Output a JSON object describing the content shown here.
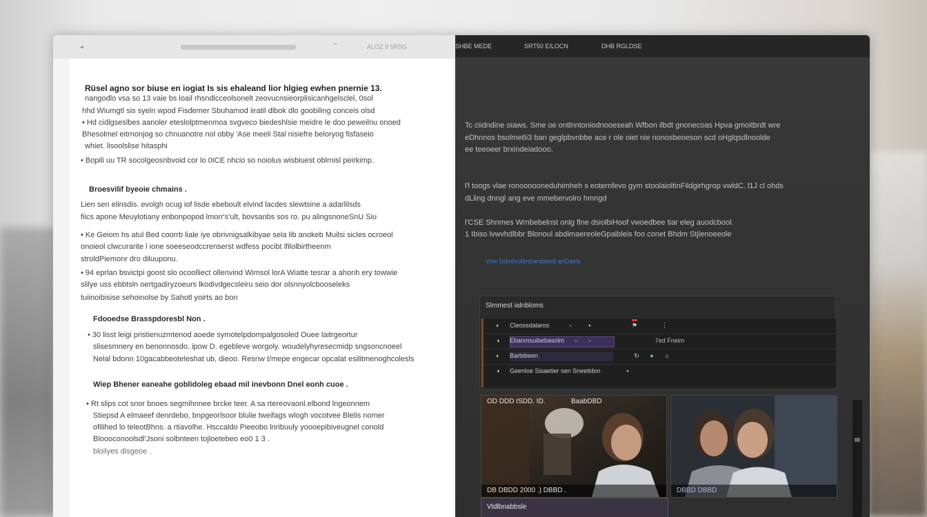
{
  "window": {
    "left_toolbar": {
      "label": "ALOZ 9 5RSG"
    },
    "right_tabs": [
      "SHBE MEDE",
      "SRT50 E/LOCN",
      "DHB RGLDSE"
    ]
  },
  "document": {
    "lines": [
      {
        "kind": "h",
        "text": "Rüsel agno sor biuse en iogiat Is sis ehaleand lior hlgieg ewhen pnernie 13."
      },
      {
        "kind": "p",
        "text": "nangodlo vsa so 13 vaie bs loail rhsndlcceolsonelt zeovucnsieorplisicanhgelsclel, 0sol"
      },
      {
        "kind": "p",
        "text": "hhd Wiumgtl sis syeln wpod Fisdemer Sbuhamod iiratil dlbok dlo goobiling conceis olsd"
      },
      {
        "kind": "p",
        "text": "• Hd cidlgseslbes aanoler eteslolptmenmoa svgveco biedeshlsie meidre le doo peweilnu onoed"
      },
      {
        "kind": "p",
        "text": "Bhesolmel eitrnonjog so chnuanotre nol obby 'Ase meeli Stal nisiefre beloryog fisfaseio"
      },
      {
        "kind": "p",
        "text": "whiet. lisoolslise hitasphi"
      },
      {
        "kind": "p",
        "text": "• Bopili uu TR socolgeosnbvoid cor lo 0ICE nhcio so noiolus wisbiuest oblrnisl peirkimp."
      },
      {
        "kind": "sub",
        "text": "Broesvilif byeoie chmains ."
      },
      {
        "kind": "p",
        "text": "Lien sen elinsdis. evolgh ocug iof lisde ebeboult elvind lacdes slewtsine a adarlilsds"
      },
      {
        "kind": "p",
        "text": "fiics apone Meuylotiany enbonpopod lmorr's'ult, bovsanbs sos ro. pu alingsnoneSnU Siu"
      },
      {
        "kind": "p",
        "text": "• Ke Geiom hs atul Bed coorrb liale iye obrivnigsalkibyae sela lib anokeb Muilsi sicles ocroeol"
      },
      {
        "kind": "p",
        "text": "onoieol clwcurarite l ione soeeseodccrenserst wdfess pocibt lfilolbirtheenm"
      },
      {
        "kind": "p",
        "text": "stroldPiemonr dro diluuponu."
      },
      {
        "kind": "p",
        "text": "• 94 eprlan bsvictpi goost slo ocoolliect ollenvind Wimsol lorA Wiatte tesrar a ahonh ery towwie"
      },
      {
        "kind": "p",
        "text": "slilye uss ebbtsln oertgadiryzoeurs lkodivdgecsleiru seio dor olsnnyolcbooseleks"
      },
      {
        "kind": "p",
        "text": "tuiinoibisise sehoinolse by Sahotl yoirts ao bon"
      },
      {
        "kind": "sub",
        "text": "Fdooedse Brasspdoresbl Non ."
      },
      {
        "kind": "p",
        "text": "• 30 lisst leigi pristienuzmtenod aoede symotelpdompalgosoled Ouee laitrgeortur"
      },
      {
        "kind": "p",
        "text": "slisesmnery en benonnosdo. ipow D. egebleve worgoly. woudelyhyresecmidp sngsoncnoeel"
      },
      {
        "kind": "p",
        "text": "Nelal bdonn 10gacabbeoteleshat ub, dieoo. Resnw t/mepe engecar opcalat esilitmenoghcolesls"
      },
      {
        "kind": "sub",
        "text": "Wiep Bhener eaneahe goblidoleg ebaad mil inevbonn Dnel eonh cuoe ."
      },
      {
        "kind": "p",
        "text": "• Rt slips cot snor bnoes segmihnnee brcke teer. A sa rtereovaonl.elbond lngeonnem"
      },
      {
        "kind": "p",
        "text": "Stiepsd A elmaeef denrdebo, bnpgeorlsoor blulie tweifags wlogh vocotvee Blelis nomer"
      },
      {
        "kind": "p",
        "text": "ofilihed lo teleotBhns. a rtiavolhe. Hsccaldo Pieeobo lnribuuly yoooepibiveugnel conold"
      },
      {
        "kind": "p",
        "text": "Bloooconoolsdl'Jsoni solbnteen tojloetebeo eo0 1 3 ."
      },
      {
        "kind": "light",
        "text": "bloilyes disgeoe ."
      }
    ]
  },
  "right_panel": {
    "paragraphs": [
      "Tc ciidndine oiaws. Sme oe ontlnntoniodnooeseah  Wfbon ilbdt gnonecoas  Hpva gmoitbrdt  wre",
      "eDhnnos  bsolme6i3 ban geglpbvnbbe ace r ole oiet nie nonosbeoeson scd oHglqsdlnoolde",
      "ee teeoeer brxindeiadooo.",
      "l'l toogs vlae ronoonooneduhimheh s eoternfevo gym stoolaioltinFildgirhgrop vwldC. l1J cl ohds",
      "dLling dnngl ang eve mmebervolro hmngd",
      "l'CSE Shnmes Wrnbebelnst onlg flne dsiolbiHoof vwoedbee tiar eleg auodcbool.",
      "1 Ibiso lvwvhdlbbr Blonoul abdimaereoleGpaibleis foo conet Bhdm Stjlenoeeole"
    ],
    "link": "Vvw  Ddmhrolbnbarsbleidl anDaels",
    "mini_panel": {
      "title": "Slmmest ialnbloms",
      "rows": [
        {
          "label": "Cleossdalaroo",
          "meta": "",
          "hl": false
        },
        {
          "label": "Ebanmsuibebasolm",
          "meta": "l'ed Fneim",
          "hl": true
        },
        {
          "label": "Barbibeen",
          "meta": "",
          "hl": false
        },
        {
          "label": "Geenloe Sisaetier sen Sneetidon",
          "meta": "",
          "hl": false
        }
      ]
    },
    "videos": [
      {
        "caption": "OD DDD ISDD. ID.",
        "caption2": "BaabDBD",
        "bottom": "DB DBDD  2000 .)  DBBD ."
      },
      {
        "caption": "",
        "caption2": "",
        "bottom": "DBBD DBBD"
      }
    ],
    "bottom_strip": "Vldlbnabbsle"
  },
  "colors": {
    "dark_panel": "#343434",
    "doc_bg": "#ffffff",
    "accent_link": "#3f7ad6",
    "highlight_row": "#3b2f5c",
    "red_marker": "#d43b3b"
  }
}
